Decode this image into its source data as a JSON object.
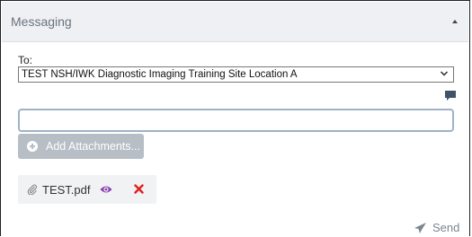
{
  "panel": {
    "title": "Messaging"
  },
  "recipient": {
    "label": "To:",
    "selected": "TEST NSH/IWK Diagnostic Imaging Training Site Location A"
  },
  "message": {
    "value": "",
    "placeholder": ""
  },
  "attachments": {
    "button_label": "Add Attachments...",
    "files": [
      {
        "name": "TEST.pdf"
      }
    ]
  },
  "send": {
    "label": "Send"
  },
  "colors": {
    "header_bg": "#eef0f3",
    "button_bg": "#b7bec6",
    "eye": "#8a3fb5",
    "remove": "#e02020",
    "input_border": "#9fb2c6"
  }
}
